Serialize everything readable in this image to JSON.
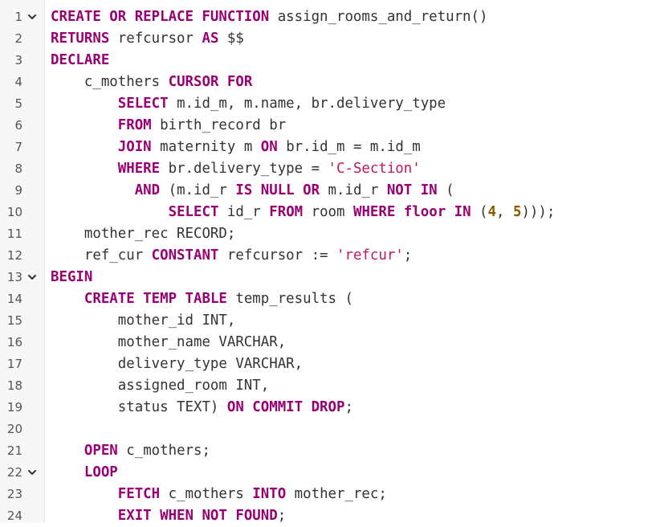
{
  "colors": {
    "keyword": "#990073",
    "identifier": "#333333",
    "string": "#c2185b",
    "number": "#8a5a00",
    "line_number": "#555555",
    "background": "#ffffff"
  },
  "fold_icon": "chevron-down-icon",
  "lines": [
    {
      "n": "1",
      "fold": true,
      "tokens": [
        {
          "t": "kw",
          "v": "CREATE OR REPLACE FUNCTION"
        },
        {
          "t": "id",
          "v": " assign_rooms_and_return()"
        }
      ]
    },
    {
      "n": "2",
      "fold": false,
      "tokens": [
        {
          "t": "kw",
          "v": "RETURNS"
        },
        {
          "t": "id",
          "v": " refcursor "
        },
        {
          "t": "kw",
          "v": "AS"
        },
        {
          "t": "id",
          "v": " $$"
        }
      ]
    },
    {
      "n": "3",
      "fold": false,
      "tokens": [
        {
          "t": "kw",
          "v": "DECLARE"
        }
      ]
    },
    {
      "n": "4",
      "fold": false,
      "tokens": [
        {
          "t": "id",
          "v": "    c_mothers "
        },
        {
          "t": "kw",
          "v": "CURSOR FOR"
        }
      ]
    },
    {
      "n": "5",
      "fold": false,
      "tokens": [
        {
          "t": "id",
          "v": "        "
        },
        {
          "t": "kw",
          "v": "SELECT"
        },
        {
          "t": "id",
          "v": " m.id_m, m.name, br.delivery_type"
        }
      ]
    },
    {
      "n": "6",
      "fold": false,
      "tokens": [
        {
          "t": "id",
          "v": "        "
        },
        {
          "t": "kw",
          "v": "FROM"
        },
        {
          "t": "id",
          "v": " birth_record br"
        }
      ]
    },
    {
      "n": "7",
      "fold": false,
      "tokens": [
        {
          "t": "id",
          "v": "        "
        },
        {
          "t": "kw",
          "v": "JOIN"
        },
        {
          "t": "id",
          "v": " maternity m "
        },
        {
          "t": "kw",
          "v": "ON"
        },
        {
          "t": "id",
          "v": " br.id_m = m.id_m"
        }
      ]
    },
    {
      "n": "8",
      "fold": false,
      "tokens": [
        {
          "t": "id",
          "v": "        "
        },
        {
          "t": "kw",
          "v": "WHERE"
        },
        {
          "t": "id",
          "v": " br.delivery_type = "
        },
        {
          "t": "str",
          "v": "'C-Section'"
        }
      ]
    },
    {
      "n": "9",
      "fold": false,
      "tokens": [
        {
          "t": "id",
          "v": "          "
        },
        {
          "t": "kw",
          "v": "AND"
        },
        {
          "t": "id",
          "v": " (m.id_r "
        },
        {
          "t": "kw",
          "v": "IS NULL OR"
        },
        {
          "t": "id",
          "v": " m.id_r "
        },
        {
          "t": "kw",
          "v": "NOT IN"
        },
        {
          "t": "id",
          "v": " ("
        }
      ]
    },
    {
      "n": "10",
      "fold": false,
      "tokens": [
        {
          "t": "id",
          "v": "              "
        },
        {
          "t": "kw",
          "v": "SELECT"
        },
        {
          "t": "id",
          "v": " id_r "
        },
        {
          "t": "kw",
          "v": "FROM"
        },
        {
          "t": "id",
          "v": " room "
        },
        {
          "t": "kw",
          "v": "WHERE"
        },
        {
          "t": "id",
          "v": " "
        },
        {
          "t": "kw",
          "v": "floor IN"
        },
        {
          "t": "id",
          "v": " ("
        },
        {
          "t": "num",
          "v": "4"
        },
        {
          "t": "id",
          "v": ", "
        },
        {
          "t": "num",
          "v": "5"
        },
        {
          "t": "id",
          "v": ")));"
        }
      ]
    },
    {
      "n": "11",
      "fold": false,
      "tokens": [
        {
          "t": "id",
          "v": "    mother_rec RECORD;"
        }
      ]
    },
    {
      "n": "12",
      "fold": false,
      "tokens": [
        {
          "t": "id",
          "v": "    ref_cur "
        },
        {
          "t": "kw",
          "v": "CONSTANT"
        },
        {
          "t": "id",
          "v": " refcursor := "
        },
        {
          "t": "str",
          "v": "'refcur'"
        },
        {
          "t": "id",
          "v": ";"
        }
      ]
    },
    {
      "n": "13",
      "fold": true,
      "tokens": [
        {
          "t": "kw",
          "v": "BEGIN"
        }
      ]
    },
    {
      "n": "14",
      "fold": false,
      "tokens": [
        {
          "t": "id",
          "v": "    "
        },
        {
          "t": "kw",
          "v": "CREATE TEMP TABLE"
        },
        {
          "t": "id",
          "v": " temp_results ("
        }
      ]
    },
    {
      "n": "15",
      "fold": false,
      "tokens": [
        {
          "t": "id",
          "v": "        mother_id INT,"
        }
      ]
    },
    {
      "n": "16",
      "fold": false,
      "tokens": [
        {
          "t": "id",
          "v": "        mother_name VARCHAR,"
        }
      ]
    },
    {
      "n": "17",
      "fold": false,
      "tokens": [
        {
          "t": "id",
          "v": "        delivery_type VARCHAR,"
        }
      ]
    },
    {
      "n": "18",
      "fold": false,
      "tokens": [
        {
          "t": "id",
          "v": "        assigned_room INT,"
        }
      ]
    },
    {
      "n": "19",
      "fold": false,
      "tokens": [
        {
          "t": "id",
          "v": "        status TEXT) "
        },
        {
          "t": "kw",
          "v": "ON COMMIT DROP"
        },
        {
          "t": "id",
          "v": ";"
        }
      ]
    },
    {
      "n": "20",
      "fold": false,
      "tokens": []
    },
    {
      "n": "21",
      "fold": false,
      "tokens": [
        {
          "t": "id",
          "v": "    "
        },
        {
          "t": "kw",
          "v": "OPEN"
        },
        {
          "t": "id",
          "v": " c_mothers;"
        }
      ]
    },
    {
      "n": "22",
      "fold": true,
      "tokens": [
        {
          "t": "id",
          "v": "    "
        },
        {
          "t": "kw",
          "v": "LOOP"
        }
      ]
    },
    {
      "n": "23",
      "fold": false,
      "tokens": [
        {
          "t": "id",
          "v": "        "
        },
        {
          "t": "kw",
          "v": "FETCH"
        },
        {
          "t": "id",
          "v": " c_mothers "
        },
        {
          "t": "kw",
          "v": "INTO"
        },
        {
          "t": "id",
          "v": " mother_rec;"
        }
      ]
    },
    {
      "n": "24",
      "fold": false,
      "tokens": [
        {
          "t": "id",
          "v": "        "
        },
        {
          "t": "kw",
          "v": "EXIT WHEN NOT FOUND"
        },
        {
          "t": "id",
          "v": ";"
        }
      ]
    }
  ]
}
